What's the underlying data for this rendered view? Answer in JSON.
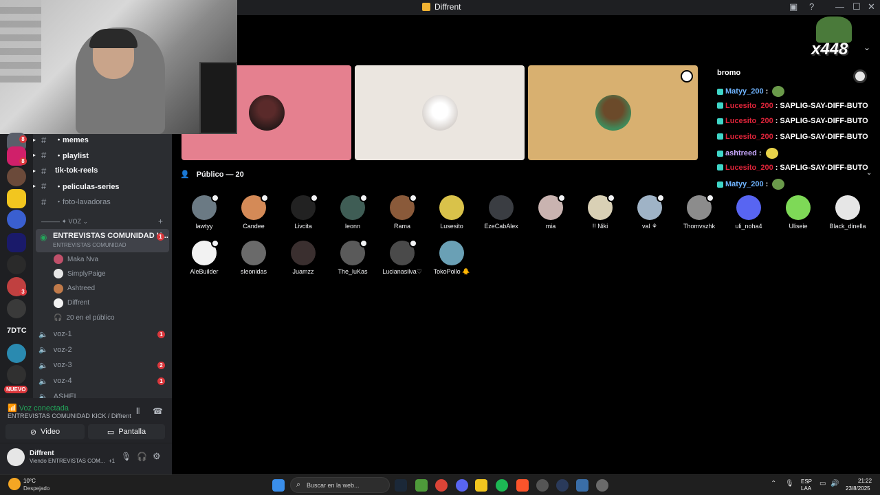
{
  "window": {
    "title": "Diffrent",
    "minimize": "—",
    "maximize": "☐",
    "close": "✕"
  },
  "overlay": {
    "count": "x448"
  },
  "stage": {
    "audience_label": "Público — 20"
  },
  "chat": {
    "title": "bromo",
    "messages": [
      {
        "user": "Matyy_200",
        "sep": ":",
        "text": "",
        "color": "#6fb4ff"
      },
      {
        "user": "Lucesito_200",
        "sep": ":",
        "text": "SAPLIG-SAY-DIFF-BUTO",
        "color": "#e0243a"
      },
      {
        "user": "Lucesito_200",
        "sep": ":",
        "text": "SAPLIG-SAY-DIFF-BUTO",
        "color": "#e0243a"
      },
      {
        "user": "Lucesito_200",
        "sep": ":",
        "text": "SAPLIG-SAY-DIFF-BUTO",
        "color": "#e0243a"
      },
      {
        "user": "ashtreed",
        "sep": ":",
        "text": "",
        "color": "#c9a8ff"
      },
      {
        "user": "Lucesito_200",
        "sep": ":",
        "text": "SAPLIG-SAY-DIFF-BUTO",
        "color": "#e0243a"
      },
      {
        "user": "Matyy_200",
        "sep": ":",
        "text": "",
        "color": "#6fb4ff"
      }
    ]
  },
  "audience": [
    {
      "name": "lawtyy",
      "color": "#6b7a84",
      "mod": true
    },
    {
      "name": "Candee",
      "color": "#d48a57",
      "mod": true
    },
    {
      "name": "Livcita",
      "color": "#222222",
      "mod": true
    },
    {
      "name": "leonn",
      "color": "#3f5d55",
      "mod": true
    },
    {
      "name": "Rama",
      "color": "#8a5a3a",
      "mod": true
    },
    {
      "name": "Lusesito",
      "color": "#d9c24a",
      "mod": false
    },
    {
      "name": "EzeCabAlex",
      "color": "#3a3d42",
      "mod": false
    },
    {
      "name": "mia",
      "color": "#c9b3b0",
      "mod": true
    },
    {
      "name": "!! Niki",
      "color": "#d9d0b5",
      "mod": true
    },
    {
      "name": "val ⚘",
      "color": "#9fb3c6",
      "mod": true
    },
    {
      "name": "Thomvszhk",
      "color": "#8c8c8c",
      "mod": true
    },
    {
      "name": "uli_noha4",
      "color": "#5865f2",
      "mod": false
    },
    {
      "name": "Uliseie",
      "color": "#7ed957",
      "mod": false
    },
    {
      "name": "Black_dinella",
      "color": "#e6e6e6",
      "mod": false
    },
    {
      "name": "AleBuilder",
      "color": "#f2f2f2",
      "mod": true
    },
    {
      "name": "sleonidas",
      "color": "#6a6a6a",
      "mod": false
    },
    {
      "name": "Juamzz",
      "color": "#3a2f2f",
      "mod": false
    },
    {
      "name": "The_luKas",
      "color": "#5a5a5a",
      "mod": true
    },
    {
      "name": "Lucianasilva♡",
      "color": "#4a4a4a",
      "mod": true
    },
    {
      "name": "TokoPollo 🐥",
      "color": "#6aa0b5",
      "mod": false
    }
  ],
  "channels": {
    "text": [
      {
        "name": "・memes",
        "dim": false
      },
      {
        "name": "・playlist",
        "dim": false
      },
      {
        "name": "tik-tok-reels",
        "dim": false
      },
      {
        "name": "・peliculas-series",
        "dim": false
      },
      {
        "name": "・foto-lavadoras",
        "dim": true
      }
    ],
    "category": "——— ✦ VOZ ⌄",
    "active_voice": {
      "name": "ENTREVISTAS COMUNIDAD K...",
      "sub": "ENTREVISTAS COMUNIDAD",
      "badge": "1"
    },
    "voice_users": [
      "Maka Nva",
      "SimplyPaige",
      "Ashtreed",
      "Diffrent"
    ],
    "audience_count": "20 en el público",
    "voice": [
      {
        "name": "voz-1",
        "badge": "1"
      },
      {
        "name": "voz-2",
        "badge": ""
      },
      {
        "name": "voz-3",
        "badge": "2"
      },
      {
        "name": "voz-4",
        "badge": "1"
      },
      {
        "name": "ASHEL",
        "badge": ""
      }
    ]
  },
  "rail": {
    "label_7dtc": "7DTC",
    "new_badge": "NUEVO",
    "badges": [
      "8",
      "8",
      "3"
    ]
  },
  "voice_panel": {
    "status": "Voz conectada",
    "location": "ENTREVISTAS COMUNIDAD KICK / Diffrent",
    "video": "Video",
    "screen": "Pantalla"
  },
  "user_panel": {
    "name": "Diffrent",
    "status": "Viendo ENTREVISTAS COM...",
    "extra": "+1"
  },
  "taskbar": {
    "weather_temp": "10°C",
    "weather_desc": "Despejado",
    "search_placeholder": "Buscar en la web...",
    "lang1": "ESP",
    "lang2": "LAA",
    "time": "21:22",
    "date": "23/8/2025"
  }
}
